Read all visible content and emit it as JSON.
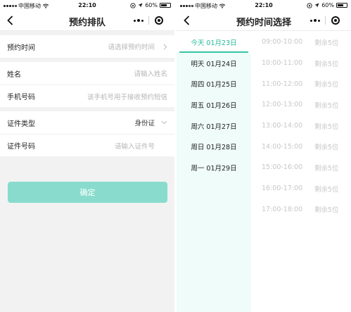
{
  "status_bar": {
    "carrier": "中国移动",
    "time": "22:10",
    "battery": "60%",
    "battery_level": 0.6
  },
  "left": {
    "title": "预约排队",
    "rows_group1": [
      {
        "label": "预约时间",
        "value": "请选择预约时间"
      }
    ],
    "rows_group2": [
      {
        "label": "姓名",
        "value": "请输入姓名"
      },
      {
        "label": "手机号码",
        "value": "该手机号用于接收预约短信"
      }
    ],
    "rows_group3": [
      {
        "label": "证件类型",
        "value": "身份证"
      },
      {
        "label": "证件号码",
        "value": "请输入证件号"
      }
    ],
    "confirm_label": "确定"
  },
  "right": {
    "title": "预约时间选择",
    "days": [
      "今天 01月23日",
      "明天 01月24日",
      "周四 01月25日",
      "周五 01月26日",
      "周六 01月27日",
      "周日 01月28日",
      "周一 01月29日"
    ],
    "selected_day_index": 0,
    "slots": [
      {
        "time": "09:00-10:00",
        "remain": "剩余5位"
      },
      {
        "time": "10:00-11:00",
        "remain": "剩余5位"
      },
      {
        "time": "11:00-12:00",
        "remain": "剩余5位"
      },
      {
        "time": "12:00-13:00",
        "remain": "剩余5位"
      },
      {
        "time": "13:00-14:00",
        "remain": "剩余5位"
      },
      {
        "time": "14:00-15:00",
        "remain": "剩余5位"
      },
      {
        "time": "15:00-16:00",
        "remain": "剩余5位"
      },
      {
        "time": "16:00-17:00",
        "remain": "剩余5位"
      },
      {
        "time": "17:00-18:00",
        "remain": "剩余5位"
      }
    ]
  },
  "colors": {
    "accent": "#37c5a5",
    "button": "#89dccd",
    "day_column": "#effcf9"
  },
  "icons": [
    "back-icon",
    "more-icon",
    "close-icon",
    "chevron-right-icon",
    "chevron-down-icon",
    "wifi-icon",
    "location-icon",
    "battery-icon"
  ]
}
